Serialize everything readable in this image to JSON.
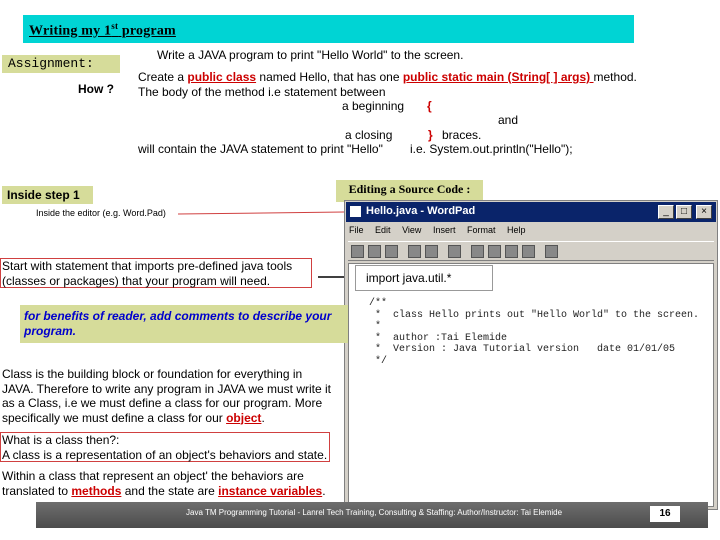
{
  "title": {
    "pre": "Writing my 1",
    "sup": "st",
    "post": " program"
  },
  "assignment": {
    "label": "Assignment:",
    "text": "Write a JAVA program to print \"Hello World\" to the screen."
  },
  "how": {
    "label": "How ?",
    "line1_pre": "Create a ",
    "line1_class": "public class",
    "line1_mid": " named Hello, that has one ",
    "line1_main": "public static main (String[ ] args) ",
    "line1_post": "method.",
    "line2": "The body of the method i.e statement between",
    "line3_a": "a beginning",
    "open_brace": "{",
    "line4": "and",
    "line5_a": "a closing",
    "close_brace": "}",
    "line5_b": "braces.",
    "line6_a": "will contain the JAVA statement to print \"Hello\"",
    "line6_b": "i.e. System.out.println(\"Hello\");"
  },
  "step": {
    "label": "Inside step 1",
    "editor_note": "Inside the editor (e.g. Word.Pad)"
  },
  "editing_label": "Editing a Source Code :",
  "imports_note": "Start with statement that imports pre-defined java tools (classes or packages) that your program will need.",
  "import_code": "import java.util.*",
  "comment_note": "for benefits of reader, add comments to describe your program.",
  "class_note": {
    "pre": "Class is the building block or foundation for everything in JAVA. Therefore to write any program in JAVA we must write it as a Class, i.e we must define a class for our program. More specifically we must define a class for our ",
    "object": "object",
    "post": "."
  },
  "what_class": {
    "q": "What is a class then?:",
    "a": "A class is a representation of an object's behaviors and state."
  },
  "within_class": {
    "pre": "Within a class that represent an object' the behaviors are translated to ",
    "methods": "methods",
    "mid": " and the state are ",
    "vars": "instance variables",
    "post": "."
  },
  "wordpad": {
    "title": "Hello.java - WordPad",
    "menu": [
      "File",
      "Edit",
      "View",
      "Insert",
      "Format",
      "Help"
    ],
    "code_lines": [
      "/**",
      " *  class Hello prints out \"Hello World\" to the screen.",
      " *",
      " *  author :Tai Elemide",
      " *  Version : Java Tutorial version   date 01/01/05",
      " */",
      ""
    ]
  },
  "footer": {
    "text": "Java TM Programming Tutorial - Lanrel Tech Training, Consulting & Staffing: Author/Instructor: Tai Elemide",
    "page": "16"
  },
  "colors": {
    "cyan": "#00d4d4",
    "olive": "#d6dc9a",
    "accent_red": "#cc0000",
    "blue_note": "#0000cc"
  }
}
